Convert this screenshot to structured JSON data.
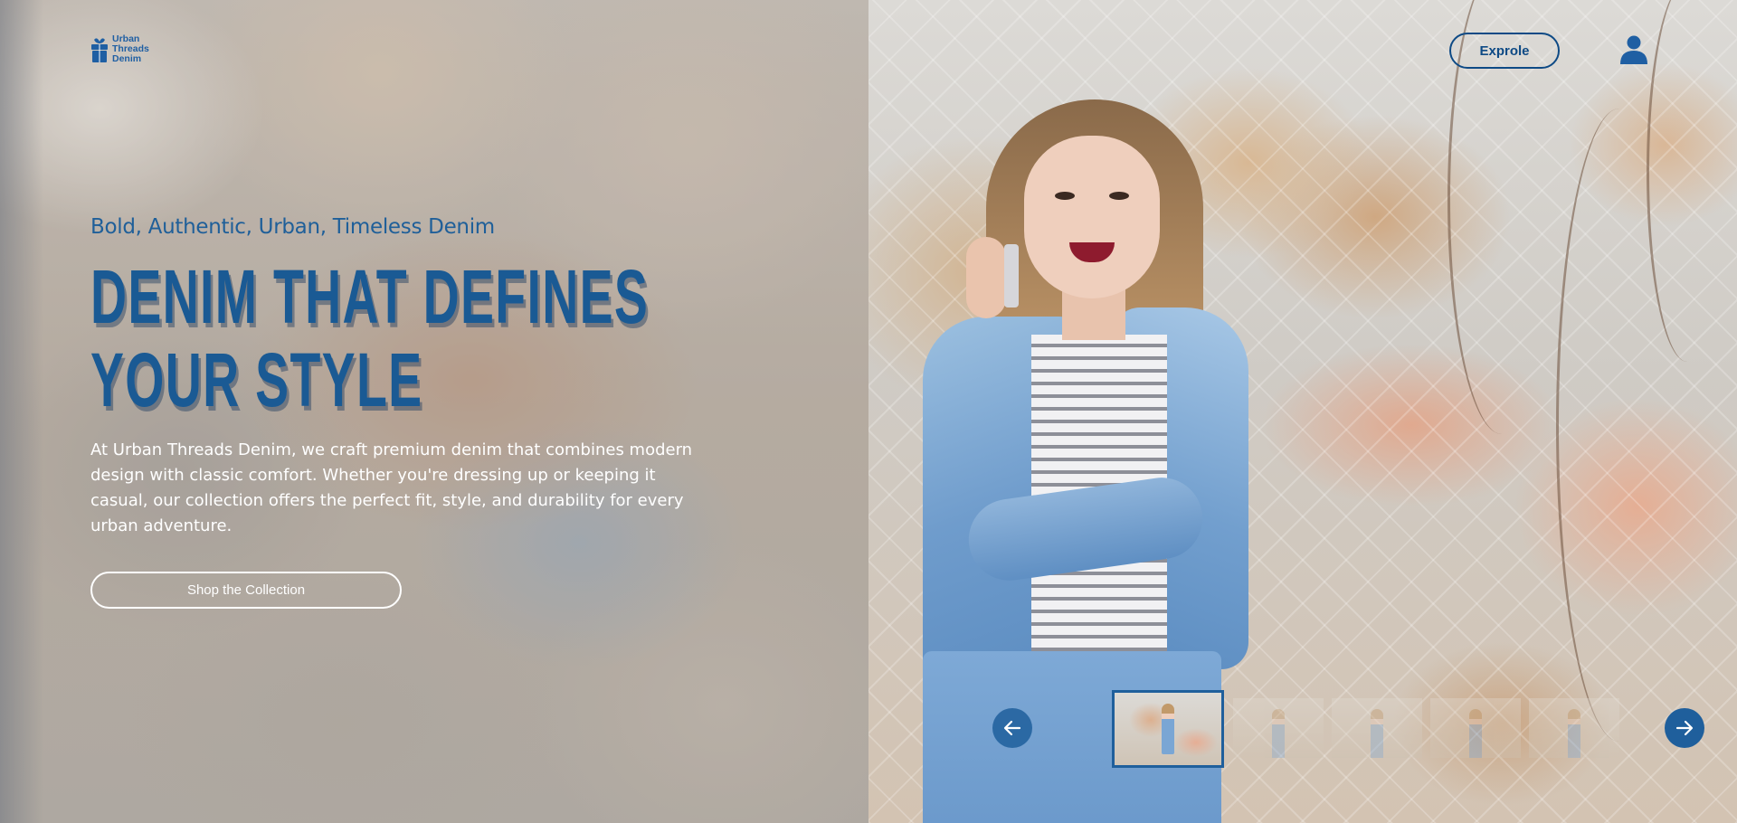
{
  "brand": {
    "name_lines": [
      "Urban",
      "Threads",
      "Denim"
    ],
    "icon": "gift-box-icon",
    "color": "#1f5fa3"
  },
  "nav": {
    "explore_label": "Exprole",
    "user_icon": "user-icon"
  },
  "hero": {
    "tagline": "Bold, Authentic, Urban, Timeless Denim",
    "headline_line1": "Denim That Defines",
    "headline_line2": "Your Style",
    "description": "At Urban Threads Denim, we craft premium denim that combines modern design with classic comfort. Whether you're dressing up or keeping it casual, our collection offers the perfect fit, style, and durability for every urban adventure.",
    "cta_label": "Shop the Collection"
  },
  "carousel": {
    "prev_icon": "arrow-left-icon",
    "next_icon": "arrow-right-icon",
    "thumbnail_count": 5,
    "active_index": 0
  },
  "colors": {
    "accent": "#1f5f9c",
    "headline": "#1a5a94",
    "explore_border": "#0e4a85",
    "text_light": "#ffffff"
  }
}
